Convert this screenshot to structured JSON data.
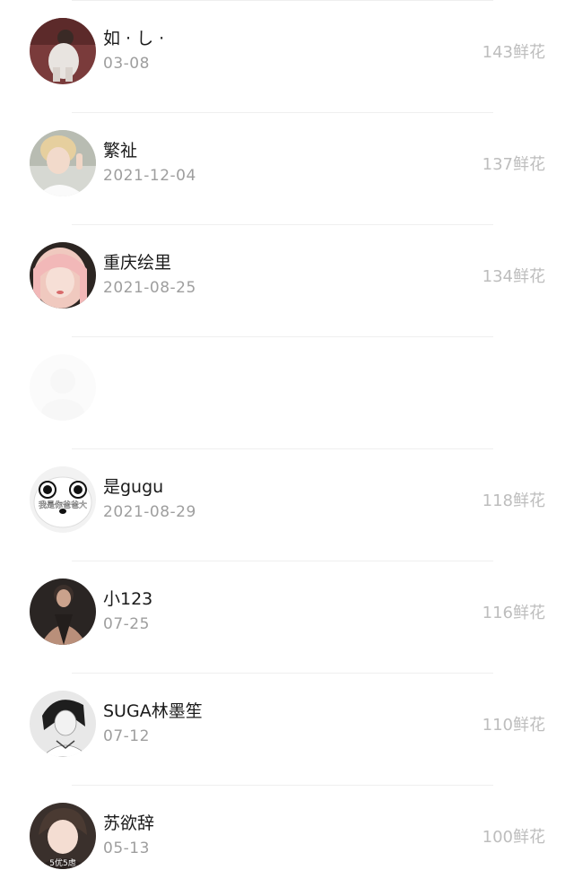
{
  "entries": [
    {
      "name": "如 · し ·",
      "date": "03-08",
      "count": "143鲜花",
      "avatar": "photo-avatar"
    },
    {
      "name": "繁祉",
      "date": "2021-12-04",
      "count": "137鲜花",
      "avatar": "photo-avatar"
    },
    {
      "name": "重庆绘里",
      "date": "2021-08-25",
      "count": "134鲜花",
      "avatar": "photo-avatar"
    },
    {
      "name": "",
      "date": "",
      "count": "",
      "avatar": "photo-avatar-faded"
    },
    {
      "name": "是gugu",
      "date": "2021-08-29",
      "count": "118鲜花",
      "avatar": "cartoon-face-avatar",
      "avatar_text": "我是你爸爸大"
    },
    {
      "name": "小123",
      "date": "07-25",
      "count": "116鲜花",
      "avatar": "photo-avatar"
    },
    {
      "name": "SUGA林墨笙",
      "date": "07-12",
      "count": "110鲜花",
      "avatar": "photo-avatar"
    },
    {
      "name": "苏欲辞",
      "date": "05-13",
      "count": "100鲜花",
      "avatar": "photo-avatar",
      "avatar_text": "5优5虑"
    }
  ],
  "colors": {
    "name_text": "#1a1a1a",
    "date_text": "#9e9e9e",
    "count_text": "#bdbdbd",
    "divider": "#efefef"
  }
}
